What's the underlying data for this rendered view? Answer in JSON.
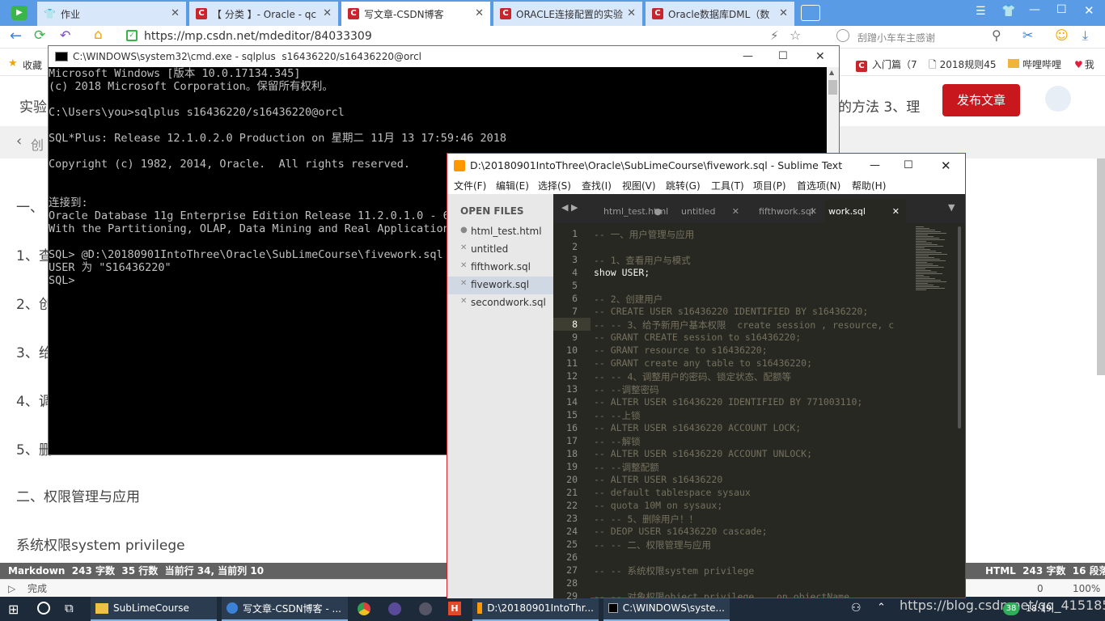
{
  "browser": {
    "tabs": [
      {
        "label": "作业"
      },
      {
        "label": "【 分类 】- Oracle - qc"
      },
      {
        "label": "写文章-CSDN博客"
      },
      {
        "label": "ORACLE连接配置的实验"
      },
      {
        "label": "Oracle数据库DML（数"
      }
    ],
    "url": "https://mp.csdn.net/mdeditor/84033309",
    "search_placeholder": "刮蹭小车车主感谢",
    "bookmarks": {
      "favorites_label": "收藏",
      "items": [
        {
          "label": "入门篇（7"
        },
        {
          "label": "2018规则45"
        },
        {
          "label": "哔哩哔哩"
        },
        {
          "label": "我"
        }
      ]
    },
    "status_text": "完成",
    "zoom": "100%",
    "counter": "0"
  },
  "editor": {
    "title_partial": "实验",
    "title_right": "的方法 3、理",
    "publish_label": "发布文章",
    "back_label": "创",
    "lines": [
      {
        "text": "一、"
      },
      {
        "text": "1、查"
      },
      {
        "text": "2、创"
      },
      {
        "text": "3、给"
      },
      {
        "text": "4、调"
      },
      {
        "text": "5、删"
      },
      {
        "text": "二、权限管理与应用"
      },
      {
        "text": "系统权限system privilege"
      }
    ],
    "status_left": "Markdown  243 字数  35 行数  当前行 34, 当前列 10",
    "status_right": "HTML  243 字数  16 段落"
  },
  "cmd": {
    "title": "C:\\WINDOWS\\system32\\cmd.exe - sqlplus  s16436220/s16436220@orcl",
    "lines": [
      "Microsoft Windows [版本 10.0.17134.345]",
      "(c) 2018 Microsoft Corporation。保留所有权利。",
      "",
      "C:\\Users\\you>sqlplus s16436220/s16436220@orcl",
      "",
      "SQL*Plus: Release 12.1.0.2.0 Production on 星期二 11月 13 17:59:46 2018",
      "",
      "Copyright (c) 1982, 2014, Oracle.  All rights reserved.",
      "",
      "",
      "连接到:",
      "Oracle Database 11g Enterprise Edition Release 11.2.0.1.0 - 64",
      "With the Partitioning, OLAP, Data Mining and Real Application",
      "",
      "SQL> @D:\\20180901IntoThree\\Oracle\\SubLimeCourse\\fivework.sql",
      "USER 为 \"S16436220\"",
      "SQL>"
    ]
  },
  "sublime": {
    "title": "D:\\20180901IntoThree\\Oracle\\SubLimeCourse\\fivework.sql - Sublime Text",
    "menu": [
      "文件(F)",
      "编辑(E)",
      "选择(S)",
      "查找(I)",
      "视图(V)",
      "跳转(G)",
      "工具(T)",
      "项目(P)",
      "首选项(N)",
      "帮助(H)"
    ],
    "open_files_label": "OPEN FILES",
    "files": [
      "html_test.html",
      "untitled",
      "fifthwork.sql",
      "fivework.sql",
      "secondwork.sql"
    ],
    "tabs": [
      "html_test.html",
      "untitled",
      "fifthwork.sql",
      "work.sql"
    ],
    "code": [
      {
        "n": "1",
        "t": "-- 一、用户管理与应用"
      },
      {
        "n": "2",
        "t": ""
      },
      {
        "n": "3",
        "t": "-- 1、查看用户与模式"
      },
      {
        "n": "4",
        "t": "show USER;"
      },
      {
        "n": "5",
        "t": ""
      },
      {
        "n": "6",
        "t": "-- 2、创建用户"
      },
      {
        "n": "7",
        "t": "-- CREATE USER s16436220 IDENTIFIED BY s16436220;"
      },
      {
        "n": "8",
        "t": "-- -- 3、给予新用户基本权限  create session , resource, c"
      },
      {
        "n": "9",
        "t": "-- GRANT CREATE session to s16436220;"
      },
      {
        "n": "10",
        "t": "-- GRANT resource to s16436220;"
      },
      {
        "n": "11",
        "t": "-- GRANT create any table to s16436220;"
      },
      {
        "n": "12",
        "t": "-- -- 4、调整用户的密码、锁定状态、配额等"
      },
      {
        "n": "13",
        "t": "-- --调整密码"
      },
      {
        "n": "14",
        "t": "-- ALTER USER s16436220 IDENTIFIED BY 771003110;"
      },
      {
        "n": "15",
        "t": "-- --上锁"
      },
      {
        "n": "16",
        "t": "-- ALTER USER s16436220 ACCOUNT LOCK;"
      },
      {
        "n": "17",
        "t": "-- --解锁"
      },
      {
        "n": "18",
        "t": "-- ALTER USER s16436220 ACCOUNT UNLOCK;"
      },
      {
        "n": "19",
        "t": "-- --调整配额"
      },
      {
        "n": "20",
        "t": "-- ALTER USER s16436220"
      },
      {
        "n": "21",
        "t": "-- default tablespace sysaux"
      },
      {
        "n": "22",
        "t": "-- quota 10M on sysaux;"
      },
      {
        "n": "23",
        "t": "-- -- 5、删除用户！！"
      },
      {
        "n": "24",
        "t": "-- DEOP USER s16436220 cascade;"
      },
      {
        "n": "25",
        "t": "-- -- 二、权限管理与应用"
      },
      {
        "n": "26",
        "t": ""
      },
      {
        "n": "27",
        "t": "-- -- 系统权限system privilege"
      },
      {
        "n": "28",
        "t": ""
      },
      {
        "n": "29",
        "t": "-- -- 对象权限object privilege    on objectName"
      }
    ]
  },
  "taskbar": {
    "items": [
      {
        "label": "SubLimeCourse"
      },
      {
        "label": "写文章-CSDN博客 - ..."
      },
      {
        "label": "D:\\20180901IntoThr..."
      },
      {
        "label": "C:\\WINDOWS\\syste..."
      }
    ],
    "watermark": "https://blog.csdn.net/qq_41518597",
    "badge": "38",
    "time": "18:19"
  }
}
